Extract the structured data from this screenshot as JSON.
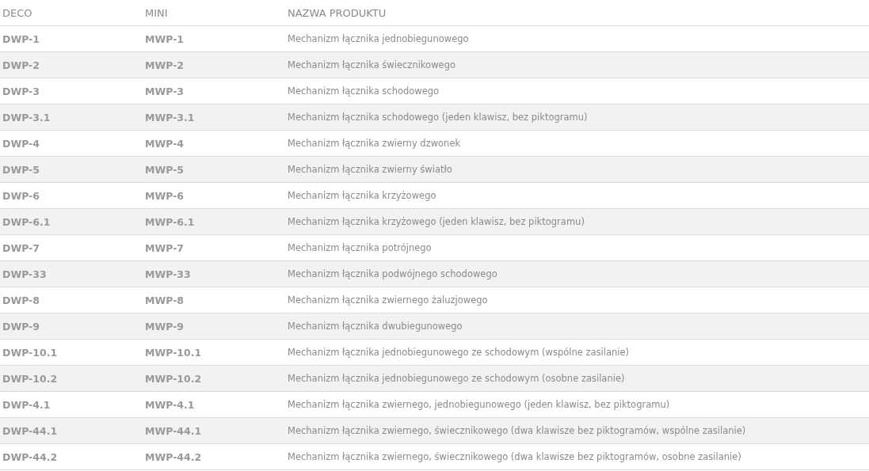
{
  "table": {
    "columns": [
      "DECO",
      "MINI",
      "NAZWA PRODUKTU"
    ],
    "rows": [
      [
        "DWP-1",
        "MWP-1",
        "Mechanizm łącznika jednobiegunowego"
      ],
      [
        "DWP-2",
        "MWP-2",
        "Mechanizm łącznika świecznikowego"
      ],
      [
        "DWP-3",
        "MWP-3",
        "Mechanizm łącznika schodowego"
      ],
      [
        "DWP-3.1",
        "MWP-3.1",
        "Mechanizm łącznika schodowego (jeden klawisz, bez piktogramu)"
      ],
      [
        "DWP-4",
        "MWP-4",
        "Mechanizm łącznika zwierny dzwonek"
      ],
      [
        "DWP-5",
        "MWP-5",
        "Mechanizm łącznika zwierny światło"
      ],
      [
        "DWP-6",
        "MWP-6",
        "Mechanizm łącznika krzyżowego"
      ],
      [
        "DWP-6.1",
        "MWP-6.1",
        "Mechanizm łącznika krzyżowego (jeden klawisz, bez piktogramu)"
      ],
      [
        "DWP-7",
        "MWP-7",
        "Mechanizm łącznika potrójnego"
      ],
      [
        "DWP-33",
        "MWP-33",
        "Mechanizm łącznika podwójnego schodowego"
      ],
      [
        "DWP-8",
        "MWP-8",
        "Mechanizm łącznika zwiernego żaluzjowego"
      ],
      [
        "DWP-9",
        "MWP-9",
        "Mechanizm łącznika dwubiegunowego"
      ],
      [
        "DWP-10.1",
        "MWP-10.1",
        "Mechanizm łącznika jednobiegunowego ze schodowym (wspólne zasilanie)"
      ],
      [
        "DWP-10.2",
        "MWP-10.2",
        "Mechanizm łącznika jednobiegunowego ze schodowym (osobne zasilanie)"
      ],
      [
        "DWP-4.1",
        "MWP-4.1",
        "Mechanizm łącznika zwiernego, jednobiegunowego (jeden klawisz, bez piktogramu)"
      ],
      [
        "DWP-44.1",
        "MWP-44.1",
        "Mechanizm łącznika zwiernego, świecznikowego (dwa klawisze bez piktogramów, wspólne zasilanie)"
      ],
      [
        "DWP-44.2",
        "MWP-44.2",
        "Mechanizm łącznika zwiernego, świecznikowego (dwa klawisze bez piktogramów, osobne zasilanie)"
      ]
    ]
  }
}
